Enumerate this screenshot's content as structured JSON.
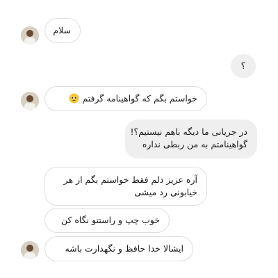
{
  "thread": {
    "messages": [
      {
        "side": "incoming",
        "lines": [
          "سلام"
        ]
      },
      {
        "side": "outgoing",
        "lines": [
          "؟"
        ]
      },
      {
        "side": "incoming",
        "lines": [
          "خواستم بگم که گواهینامه گرفتم"
        ],
        "emoji": "pleading-face-icon"
      },
      {
        "side": "outgoing",
        "lines": [
          "در جریانی ما دیگه باهم نیستیم؟!",
          "گواهینامتم به من ربطی نداره"
        ]
      },
      {
        "side": "incoming",
        "lines": [
          "آره عزیز دلم فقط خواستم بگم از هر",
          "خیابونی رد میشی"
        ]
      },
      {
        "side": "incoming",
        "lines": [
          "خوب چپ و راستتو نگاه کن"
        ]
      },
      {
        "side": "incoming",
        "lines": [
          "ایشالا خدا حافظ و نگهدارت باشه"
        ]
      }
    ]
  },
  "colors": {
    "incoming_bubble_bg": "#ffffff",
    "incoming_bubble_border": "#dedede",
    "outgoing_bubble_bg": "#efefef",
    "text": "#1a1a1a",
    "emoji_yellow": "#f7c531"
  }
}
